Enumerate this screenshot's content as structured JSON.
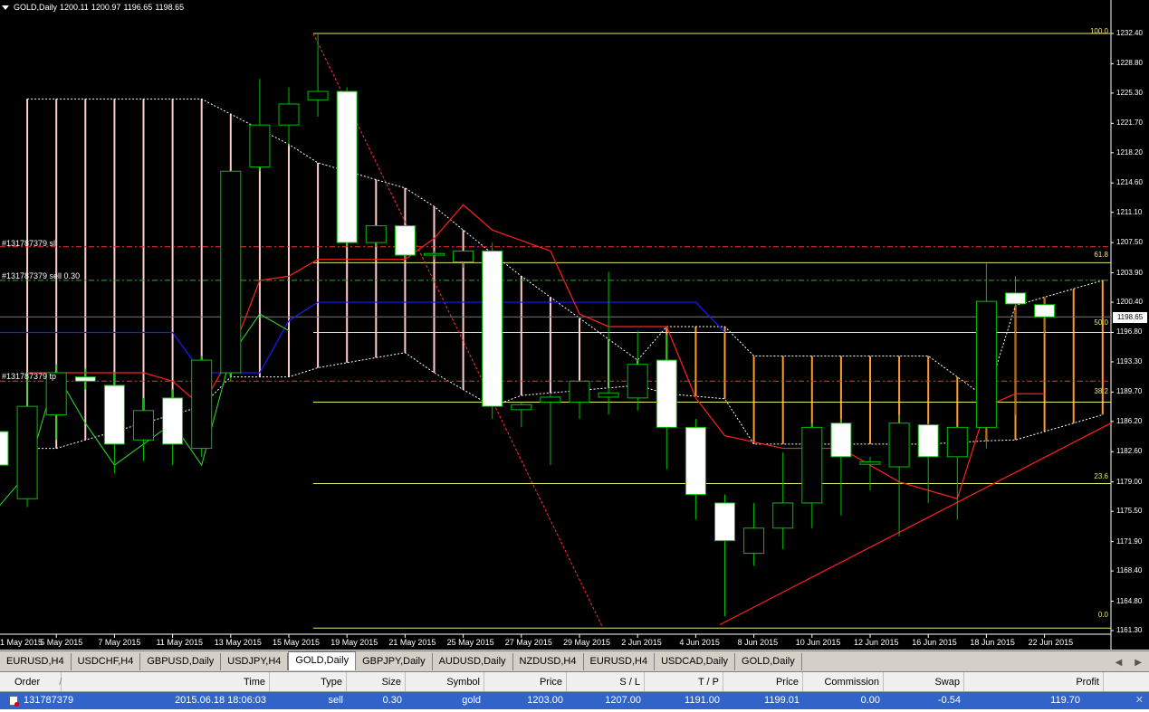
{
  "header": {
    "symbol_timeframe": "GOLD,Daily",
    "ohlc": [
      "1200.11",
      "1200.97",
      "1196.65",
      "1198.65"
    ]
  },
  "order_lines": {
    "sl_label": "#131787379 sl",
    "sell_label": "#131787379 sell 0.30",
    "tp_label": "#131787379 tp"
  },
  "fib_levels": {
    "l100": "100.0",
    "l61": "61.8",
    "l50": "50.0",
    "l38": "38.2",
    "l23": "23.6",
    "l0": "0.0"
  },
  "current_price": "1198.65",
  "colors": {
    "bull": "#00c000",
    "bear_body": "#ffffff",
    "fib": "#e8e86a",
    "ma_red": "#ff2020",
    "ma_blue": "#1a1aff",
    "cloud_bear": "#ffcccc",
    "cloud_bull": "#ff9933",
    "order_red": "#ff3030",
    "order_green": "#33aa33",
    "orange": "#ffaa33",
    "selected_row": "#3163c9"
  },
  "chart_data": {
    "type": "candlestick",
    "symbol": "GOLD",
    "timeframe": "Daily",
    "ylim": [
      1161.3,
      1232.4
    ],
    "y_ticks": [
      1232.4,
      1228.8,
      1225.3,
      1221.7,
      1218.2,
      1214.6,
      1211.1,
      1207.5,
      1203.9,
      1200.4,
      1196.8,
      1193.3,
      1189.7,
      1186.2,
      1182.6,
      1179.0,
      1175.5,
      1171.9,
      1168.4,
      1164.8,
      1161.3
    ],
    "y_tick_labels": [
      "1232.40",
      "1228.80",
      "1225.30",
      "1221.70",
      "1218.20",
      "1214.60",
      "1211.10",
      "1207.50",
      "1203.90",
      "1200.40",
      "1196.80",
      "1193.30",
      "1189.70",
      "1186.20",
      "1182.60",
      "1179.00",
      "1175.50",
      "1171.90",
      "1168.40",
      "1164.80",
      "1161.30"
    ],
    "x_labels": [
      "1 May 2015",
      "5 May 2015",
      "7 May 2015",
      "11 May 2015",
      "13 May 2015",
      "15 May 2015",
      "19 May 2015",
      "21 May 2015",
      "25 May 2015",
      "27 May 2015",
      "29 May 2015",
      "2 Jun 2015",
      "4 Jun 2015",
      "8 Jun 2015",
      "10 Jun 2015",
      "12 Jun 2015",
      "16 Jun 2015",
      "18 Jun 2015",
      "22 Jun 2015"
    ],
    "candles": [
      {
        "o": 1185,
        "h": 1189,
        "l": 1178,
        "c": 1181
      },
      {
        "o": 1177,
        "h": 1192,
        "l": 1176,
        "c": 1188
      },
      {
        "o": 1187,
        "h": 1193,
        "l": 1184,
        "c": 1192
      },
      {
        "o": 1191.5,
        "h": 1192.5,
        "l": 1190,
        "c": 1191
      },
      {
        "o": 1190.5,
        "h": 1192,
        "l": 1180,
        "c": 1183.5
      },
      {
        "o": 1184,
        "h": 1189,
        "l": 1181.5,
        "c": 1187.5
      },
      {
        "o": 1189,
        "h": 1190,
        "l": 1181,
        "c": 1183.5
      },
      {
        "o": 1183,
        "h": 1194,
        "l": 1182,
        "c": 1193.5
      },
      {
        "o": 1192,
        "h": 1216,
        "l": 1191,
        "c": 1216
      },
      {
        "o": 1216.5,
        "h": 1227,
        "l": 1216,
        "c": 1221.5
      },
      {
        "o": 1221.5,
        "h": 1226,
        "l": 1219,
        "c": 1224
      },
      {
        "o": 1224.5,
        "h": 1232.4,
        "l": 1222.5,
        "c": 1225.5
      },
      {
        "o": 1225.5,
        "h": 1226,
        "l": 1207,
        "c": 1207.5
      },
      {
        "o": 1207.5,
        "h": 1209.5,
        "l": 1207,
        "c": 1209.5
      },
      {
        "o": 1209.5,
        "h": 1209.5,
        "l": 1205.5,
        "c": 1206
      },
      {
        "o": 1206,
        "h": 1206.5,
        "l": 1205.5,
        "c": 1206.2
      },
      {
        "o": 1205.2,
        "h": 1206.5,
        "l": 1204.5,
        "c": 1206.5
      },
      {
        "o": 1206.5,
        "h": 1207.5,
        "l": 1186.5,
        "c": 1188
      },
      {
        "o": 1187.6,
        "h": 1188.5,
        "l": 1185.5,
        "c": 1188.2
      },
      {
        "o": 1188.5,
        "h": 1189.5,
        "l": 1181,
        "c": 1189.1
      },
      {
        "o": 1188.5,
        "h": 1191,
        "l": 1186.5,
        "c": 1191
      },
      {
        "o": 1189.1,
        "h": 1204,
        "l": 1187,
        "c": 1189.6
      },
      {
        "o": 1189,
        "h": 1197,
        "l": 1187.5,
        "c": 1193
      },
      {
        "o": 1193.5,
        "h": 1196.5,
        "l": 1180.5,
        "c": 1185.5
      },
      {
        "o": 1185.5,
        "h": 1186.5,
        "l": 1174.5,
        "c": 1177.5
      },
      {
        "o": 1176.5,
        "h": 1177.5,
        "l": 1163,
        "c": 1172
      },
      {
        "o": 1170.5,
        "h": 1176.5,
        "l": 1169,
        "c": 1173.5
      },
      {
        "o": 1173.5,
        "h": 1182.5,
        "l": 1171,
        "c": 1176.5
      },
      {
        "o": 1176.5,
        "h": 1186,
        "l": 1173.5,
        "c": 1185.5
      },
      {
        "o": 1186,
        "h": 1186.5,
        "l": 1175,
        "c": 1182
      },
      {
        "o": 1181.1,
        "h": 1182,
        "l": 1178,
        "c": 1181.4
      },
      {
        "o": 1180.8,
        "h": 1187,
        "l": 1172.5,
        "c": 1186
      },
      {
        "o": 1185.8,
        "h": 1186,
        "l": 1176.5,
        "c": 1182
      },
      {
        "o": 1182,
        "h": 1185.5,
        "l": 1174.5,
        "c": 1185.5
      },
      {
        "o": 1185.5,
        "h": 1205,
        "l": 1183,
        "c": 1200.5
      },
      {
        "o": 1201.5,
        "h": 1203.5,
        "l": 1187,
        "c": 1200.2
      },
      {
        "o": 1200.11,
        "h": 1200.97,
        "l": 1196.65,
        "c": 1198.65
      }
    ],
    "fib_levels": [
      {
        "label": "100.0",
        "price": 1232.4
      },
      {
        "label": "61.8",
        "price": 1205.1
      },
      {
        "label": "50.0",
        "price": 1196.8
      },
      {
        "label": "38.2",
        "price": 1188.5
      },
      {
        "label": "23.6",
        "price": 1178.8
      },
      {
        "label": "0.0",
        "price": 1161.6
      }
    ],
    "order": {
      "entry": 1203.0,
      "sl": 1207.0,
      "tp": 1191.0
    }
  },
  "tabs": [
    "EURUSD,H4",
    "USDCHF,H4",
    "GBPUSD,Daily",
    "USDJPY,H4",
    "GOLD,Daily",
    "GBPJPY,Daily",
    "AUDUSD,Daily",
    "NZDUSD,H4",
    "EURUSD,H4",
    "USDCAD,Daily",
    "GOLD,Daily"
  ],
  "active_tab_index": 4,
  "tab_arrows": [
    "◀",
    "▶"
  ],
  "terminal": {
    "headers": [
      "Order",
      "Time",
      "Type",
      "Size",
      "Symbol",
      "Price",
      "S / L",
      "T / P",
      "Price",
      "Commission",
      "Swap",
      "Profit"
    ],
    "sort_indicator": "/",
    "row": [
      "131787379",
      "2015.06.18 18:06:03",
      "sell",
      "0.30",
      "gold",
      "1203.00",
      "1207.00",
      "1191.00",
      "1199.01",
      "0.00",
      "-0.54",
      "119.70"
    ],
    "close_icon": "✕"
  }
}
